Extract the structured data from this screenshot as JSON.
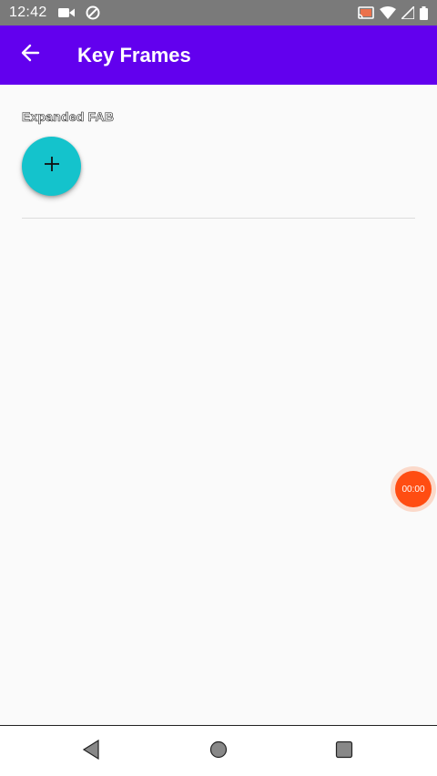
{
  "status_bar": {
    "time": "12:42",
    "icons": [
      "video-camera-icon",
      "data-saver-icon",
      "cast-icon",
      "wifi-icon",
      "signal-icon",
      "battery-icon"
    ]
  },
  "app_bar": {
    "title": "Key Frames",
    "back_icon": "arrow-back-icon",
    "color": "#6200ee"
  },
  "main": {
    "section_label": "Expanded FAB",
    "fab_icon": "plus-icon",
    "fab_color": "#14c3cc"
  },
  "recorder": {
    "timer": "00:00",
    "color": "#ff4d12"
  },
  "nav_bar": {
    "buttons": [
      "back-triangle-icon",
      "home-circle-icon",
      "recents-square-icon"
    ]
  }
}
